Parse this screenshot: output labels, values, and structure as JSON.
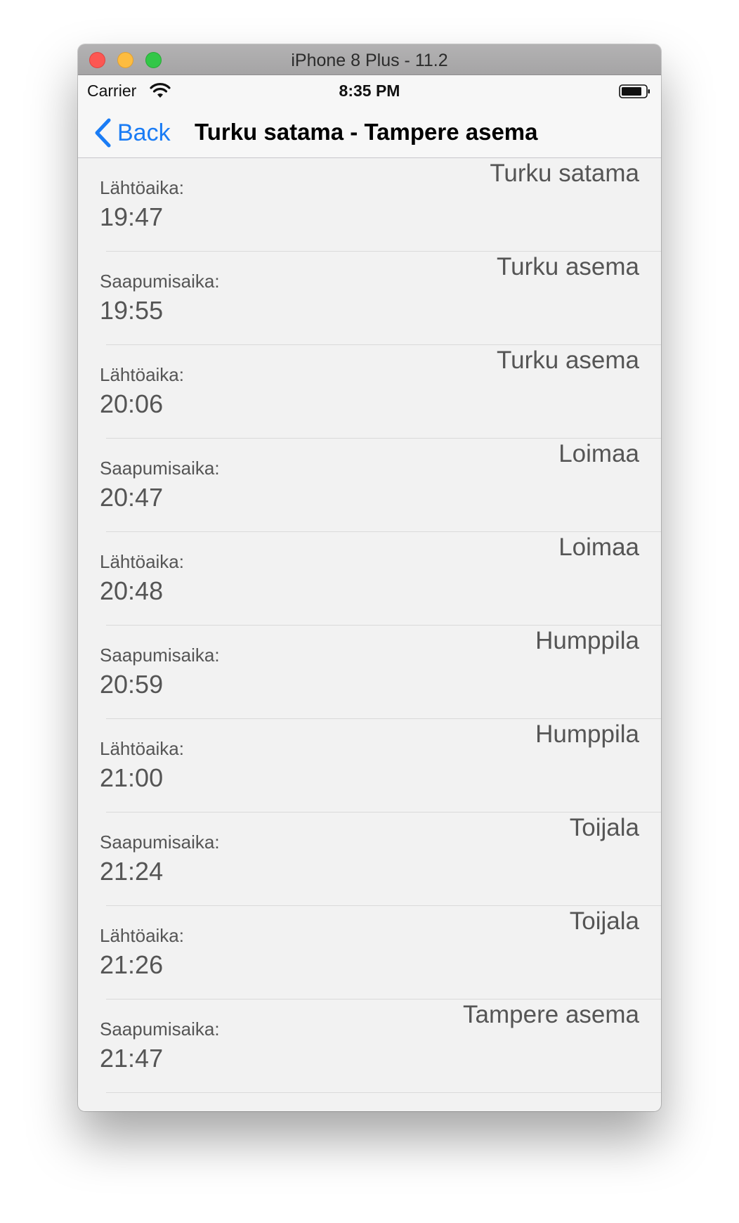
{
  "window": {
    "title": "iPhone 8 Plus - 11.2"
  },
  "status_bar": {
    "carrier": "Carrier",
    "time": "8:35 PM"
  },
  "nav": {
    "back_label": "Back",
    "title": "Turku satama - Tampere asema"
  },
  "rows": [
    {
      "label": "Lähtöaika:",
      "time": "19:47",
      "station": "Turku satama"
    },
    {
      "label": "Saapumisaika:",
      "time": "19:55",
      "station": "Turku asema"
    },
    {
      "label": "Lähtöaika:",
      "time": "20:06",
      "station": "Turku asema"
    },
    {
      "label": "Saapumisaika:",
      "time": "20:47",
      "station": "Loimaa"
    },
    {
      "label": "Lähtöaika:",
      "time": "20:48",
      "station": "Loimaa"
    },
    {
      "label": "Saapumisaika:",
      "time": "20:59",
      "station": "Humppila"
    },
    {
      "label": "Lähtöaika:",
      "time": "21:00",
      "station": "Humppila"
    },
    {
      "label": "Saapumisaika:",
      "time": "21:24",
      "station": "Toijala"
    },
    {
      "label": "Lähtöaika:",
      "time": "21:26",
      "station": "Toijala"
    },
    {
      "label": "Saapumisaika:",
      "time": "21:47",
      "station": "Tampere asema"
    }
  ],
  "colors": {
    "accent": "#1a7cf5",
    "row_text": "#555555",
    "list_background": "#f2f2f2"
  }
}
